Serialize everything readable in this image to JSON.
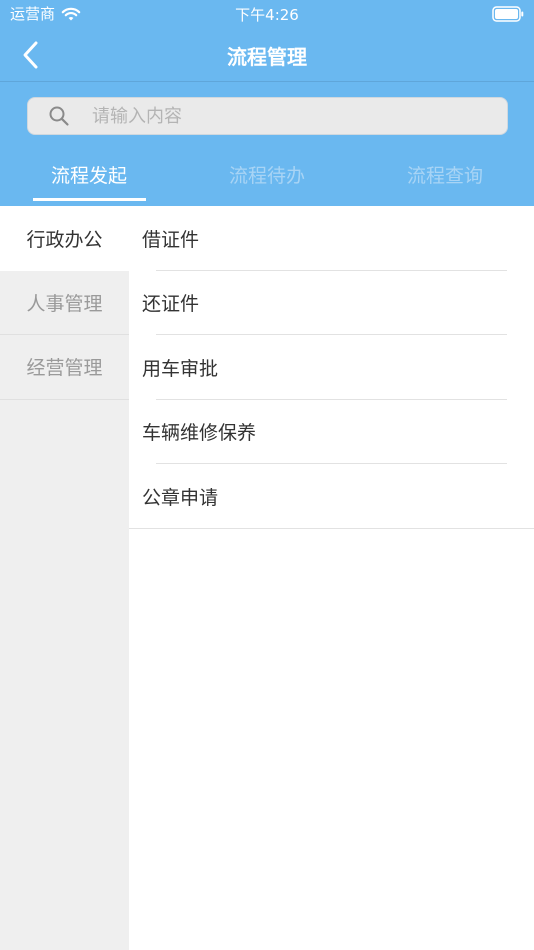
{
  "status_bar": {
    "carrier": "运营商",
    "time": "下午4:26",
    "wifi_icon": "wifi-icon",
    "battery_icon": "battery-icon"
  },
  "nav": {
    "title": "流程管理",
    "back_icon": "chevron-left-icon"
  },
  "search": {
    "placeholder": "请输入内容",
    "value": "",
    "icon": "search-icon"
  },
  "tabs": [
    {
      "label": "流程发起",
      "active": true
    },
    {
      "label": "流程待办",
      "active": false
    },
    {
      "label": "流程查询",
      "active": false
    }
  ],
  "categories": [
    {
      "label": "行政办公",
      "active": true
    },
    {
      "label": "人事管理",
      "active": false
    },
    {
      "label": "经营管理",
      "active": false
    }
  ],
  "processes": [
    {
      "label": "借证件"
    },
    {
      "label": "还证件"
    },
    {
      "label": "用车审批"
    },
    {
      "label": "车辆维修保养"
    },
    {
      "label": "公章申请"
    }
  ],
  "colors": {
    "header": "#6ab8f0",
    "tab_inactive": "#a8d4f5",
    "sidebar_bg": "#efefef",
    "text_primary": "#333333",
    "text_muted": "#9a9a9a"
  }
}
